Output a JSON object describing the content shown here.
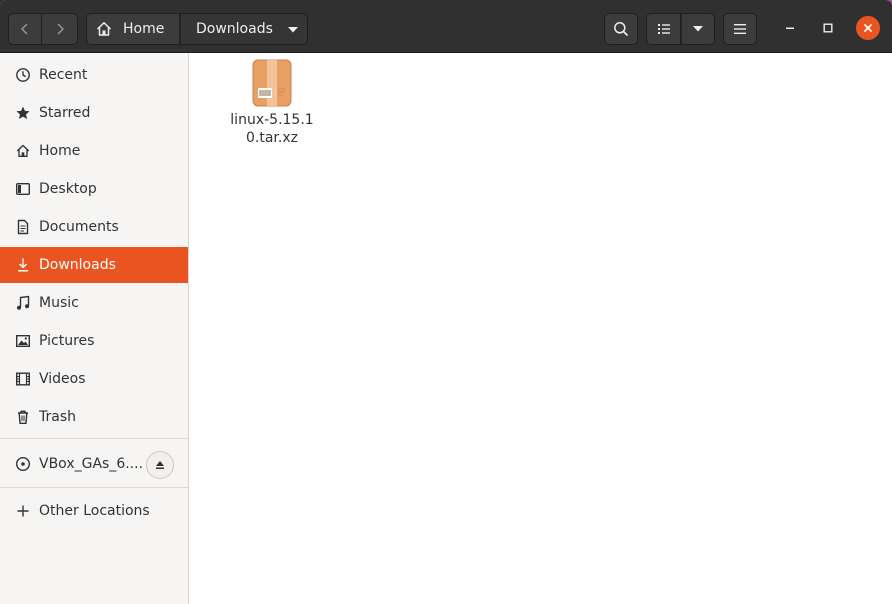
{
  "window": {
    "title": "Downloads"
  },
  "header": {
    "back_icon": "chevron-left-icon",
    "forward_icon": "chevron-right-icon",
    "breadcrumb": [
      {
        "label": "Home",
        "icon": "home-icon"
      },
      {
        "label": "Downloads",
        "icon": "chevron-down-icon"
      }
    ],
    "search_icon": "search-icon",
    "view_icon": "list-view-icon",
    "view_options_icon": "chevron-down-icon",
    "menu_icon": "hamburger-menu-icon",
    "window_controls": [
      "minimize-icon",
      "maximize-icon",
      "close-icon"
    ],
    "accent_color": "#e95420"
  },
  "sidebar": {
    "places": [
      {
        "label": "Recent",
        "icon": "clock-icon"
      },
      {
        "label": "Starred",
        "icon": "star-icon"
      },
      {
        "label": "Home",
        "icon": "home-icon"
      },
      {
        "label": "Desktop",
        "icon": "desktop-icon"
      },
      {
        "label": "Documents",
        "icon": "document-icon"
      },
      {
        "label": "Downloads",
        "icon": "download-icon",
        "active": true
      },
      {
        "label": "Music",
        "icon": "music-note-icon"
      },
      {
        "label": "Pictures",
        "icon": "picture-icon"
      },
      {
        "label": "Videos",
        "icon": "film-icon"
      },
      {
        "label": "Trash",
        "icon": "trash-icon"
      }
    ],
    "devices": [
      {
        "label": "VBox_GAs_6....",
        "icon": "disc-icon",
        "eject_icon": "eject-icon"
      }
    ],
    "other": {
      "label": "Other Locations",
      "icon": "plus-icon"
    }
  },
  "content": {
    "files": [
      {
        "name": "linux-5.15.10.tar.xz",
        "icon": "archive-icon"
      }
    ]
  }
}
